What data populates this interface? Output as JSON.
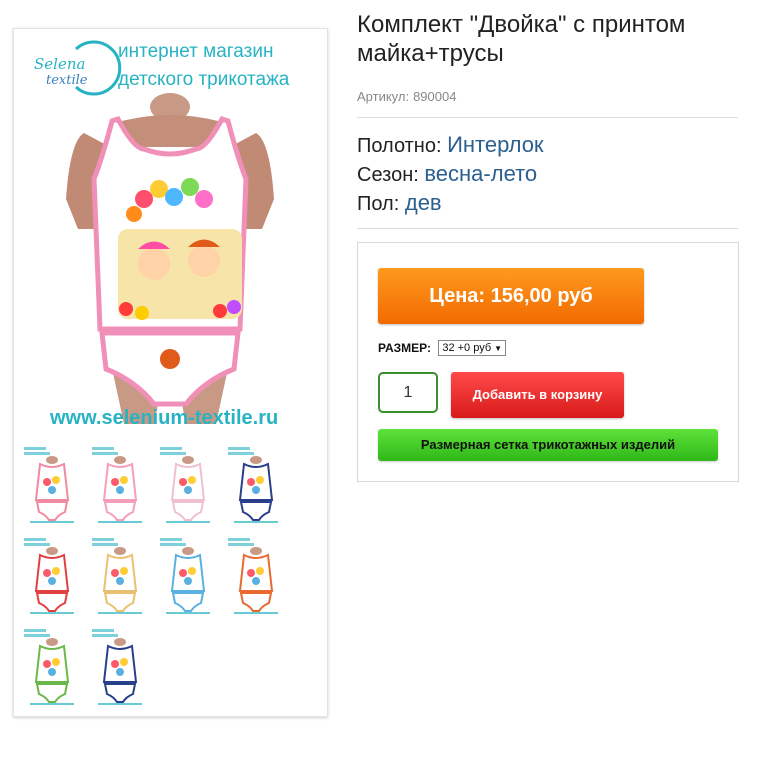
{
  "product": {
    "title": "Комплект \"Двойка\" с принтом майка+трусы",
    "sku_label": "Артикул:",
    "sku_value": "890004"
  },
  "attributes": [
    {
      "label": "Полотно:",
      "value": "Интерлок"
    },
    {
      "label": "Сезон:",
      "value": "весна-лето"
    },
    {
      "label": "Пол:",
      "value": "дев"
    }
  ],
  "buy_box": {
    "price_label": "Цена: 156,00 руб",
    "size_label": "РАЗМЕР:",
    "size_selected": "32 +0 руб",
    "quantity": "1",
    "add_to_cart_label": "Добавить в корзину",
    "size_chart_label": "Размерная сетка трикотажных изделий"
  },
  "gallery": {
    "brand_logo_line1": "Selena",
    "brand_logo_line2": "textile",
    "banner_line1": "интернет магазин",
    "banner_line2": "детского трикотажа",
    "website": "www.selenium-textile.ru",
    "thumbnails": [
      {
        "name": "thumb-1",
        "trim": "#f08aa0"
      },
      {
        "name": "thumb-2",
        "trim": "#f5a0b8"
      },
      {
        "name": "thumb-3",
        "trim": "#f0c0d0"
      },
      {
        "name": "thumb-4",
        "trim": "#2a3f8a"
      },
      {
        "name": "thumb-5",
        "trim": "#e04040"
      },
      {
        "name": "thumb-6",
        "trim": "#e8c070"
      },
      {
        "name": "thumb-7",
        "trim": "#5ab0e0"
      },
      {
        "name": "thumb-8",
        "trim": "#e86a30"
      },
      {
        "name": "thumb-9",
        "trim": "#6ab84a"
      },
      {
        "name": "thumb-10",
        "trim": "#2a3f8a"
      }
    ]
  },
  "colors": {
    "price_button": "#f7800e",
    "cart_button": "#e83030",
    "size_chart_button": "#45cc2a",
    "attribute_value": "#2b5f8f",
    "banner_text": "#27b3c3"
  }
}
